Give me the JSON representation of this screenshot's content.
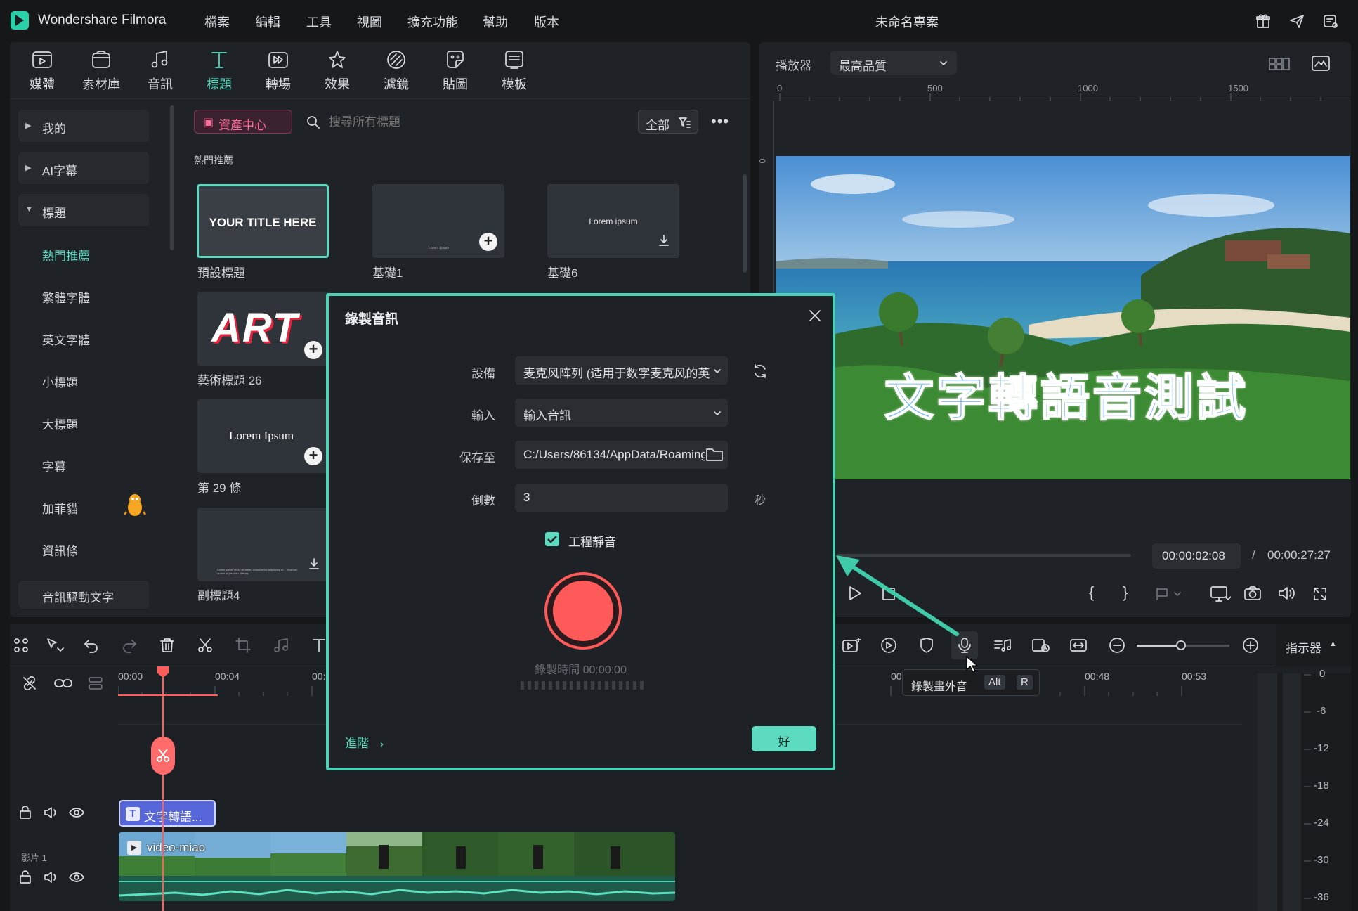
{
  "app": {
    "name": "Wondershare Filmora",
    "project_title": "未命名專案",
    "menu": [
      "檔案",
      "編輯",
      "工具",
      "視圖",
      "擴充功能",
      "幫助",
      "版本"
    ]
  },
  "library": {
    "tabs": [
      {
        "label": "媒體",
        "icon": "media-icon"
      },
      {
        "label": "素材庫",
        "icon": "stock-icon"
      },
      {
        "label": "音訊",
        "icon": "music-note-icon"
      },
      {
        "label": "標題",
        "icon": "title-t-icon",
        "active": true
      },
      {
        "label": "轉場",
        "icon": "transition-icon"
      },
      {
        "label": "效果",
        "icon": "effects-icon"
      },
      {
        "label": "濾鏡",
        "icon": "filter-icon"
      },
      {
        "label": "貼圖",
        "icon": "sticker-icon"
      },
      {
        "label": "模板",
        "icon": "template-icon"
      }
    ],
    "sidebar": {
      "groups": [
        "我的",
        "AI字幕",
        "標題"
      ],
      "subitems": [
        "熱門推薦",
        "繁體字體",
        "英文字體",
        "小標題",
        "大標題",
        "字幕",
        "加菲貓",
        "資訊條"
      ],
      "bottom": "音訊驅動文字"
    },
    "asset_center": "資產中心",
    "search_placeholder": "搜尋所有標題",
    "filter_label": "全部",
    "section_title": "熱門推薦",
    "cards": [
      {
        "label": "預設標題",
        "preview_text": "YOUR TITLE HERE"
      },
      {
        "label": "基礎1",
        "preview_text": "Lorem ipsum"
      },
      {
        "label": "基礎6",
        "preview_text": "Lorem ipsum"
      },
      {
        "label": "藝術標題 26",
        "preview_text": "ART"
      },
      {
        "label": "第 29 條",
        "preview_text": "Lorem Ipsum"
      },
      {
        "label": "副標題4",
        "preview_text": "Lorem ipsum dolor sit amet, consectetur adipiscing el... Vivamus auctor et justo eu ultrices."
      }
    ]
  },
  "player": {
    "label": "播放器",
    "quality": "最高品質",
    "ruler_marks": [
      "0",
      "500",
      "1000",
      "1500"
    ],
    "ruler_left_mark": "0",
    "overlay_text": "文字轉語音測試",
    "current_time": "00:00:02:08",
    "separator": "/",
    "total_time": "00:00:27:27"
  },
  "timeline": {
    "time_marks": [
      "00:00",
      "00:04",
      "00:",
      "00",
      "00:48",
      "00:53"
    ],
    "meter_label": "指示器",
    "meter_marks": [
      "0",
      "-6",
      "-12",
      "-18",
      "-24",
      "-30",
      "-36"
    ],
    "title_clip": "文字轉語...",
    "video_clip": "video-miao",
    "track_label": "影片 1",
    "tooltip": {
      "label": "錄製畫外音",
      "keys": [
        "Alt",
        "R"
      ]
    }
  },
  "dialog": {
    "title": "錄製音訊",
    "device_label": "設備",
    "device_value": "麦克风阵列 (适用于数字麦克风的英",
    "input_label": "輸入",
    "input_value": "輸入音訊",
    "save_label": "保存至",
    "save_value": "C:/Users/86134/AppData/Roaming",
    "countdown_label": "倒數",
    "countdown_value": "3",
    "countdown_unit": "秒",
    "mute_label": "工程靜音",
    "mute_checked": true,
    "record_time": "錄製時間 00:00:00",
    "advanced": "進階",
    "ok": "好"
  },
  "colors": {
    "accent": "#5ddbc1",
    "record": "#ff5a5a",
    "playhead": "#ff5c5c",
    "title_clip": "#5c6fe0"
  }
}
